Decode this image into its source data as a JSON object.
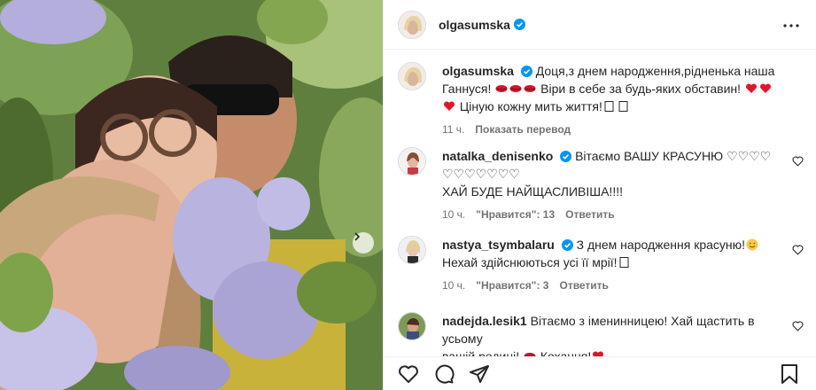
{
  "post": {
    "author": "olgasumska",
    "carousel_next_icon": "chevron-right-icon"
  },
  "caption": {
    "username": "olgasumska",
    "text_part1": "Доця,з днем народження,рідненька наша Ганнуся! ",
    "text_part2": "Віри в себе за будь-яких обставин! ",
    "text_part3": " Цiную кожну мить життя!",
    "time": "11 ч.",
    "translate_label": "Показать перевод"
  },
  "comments": [
    {
      "username": "natalka_denisenko",
      "line1": "Вітаємо ВАШУ КРАСУНЮ ♡♡♡♡",
      "line2": "♡♡♡♡♡♡♡",
      "line3": "ХАЙ БУДЕ НАЙЩАСЛИВІША!!!!",
      "time": "10 ч.",
      "likes": "\"Нравится\": 13",
      "reply": "Ответить"
    },
    {
      "username": "nastya_tsymbalaru",
      "line1": "З днем народження красуню!",
      "line2": "Нехай здійснюються усі її мрії!",
      "time": "10 ч.",
      "likes": "\"Нравится\": 3",
      "reply": "Ответить"
    },
    {
      "username": "nadejda.lesik1",
      "line1": "Вітаємо з іменинницею! Хай щастить в усьому",
      "line2": "вашій родині! ",
      "line2b": " Кохання!"
    }
  ],
  "colors": {
    "verified": "#0095f6",
    "heart": "#ed4956",
    "muted": "#737373",
    "text": "#262626"
  },
  "action_icons": [
    "heart-icon",
    "comment-icon",
    "share-icon",
    "bookmark-icon"
  ]
}
